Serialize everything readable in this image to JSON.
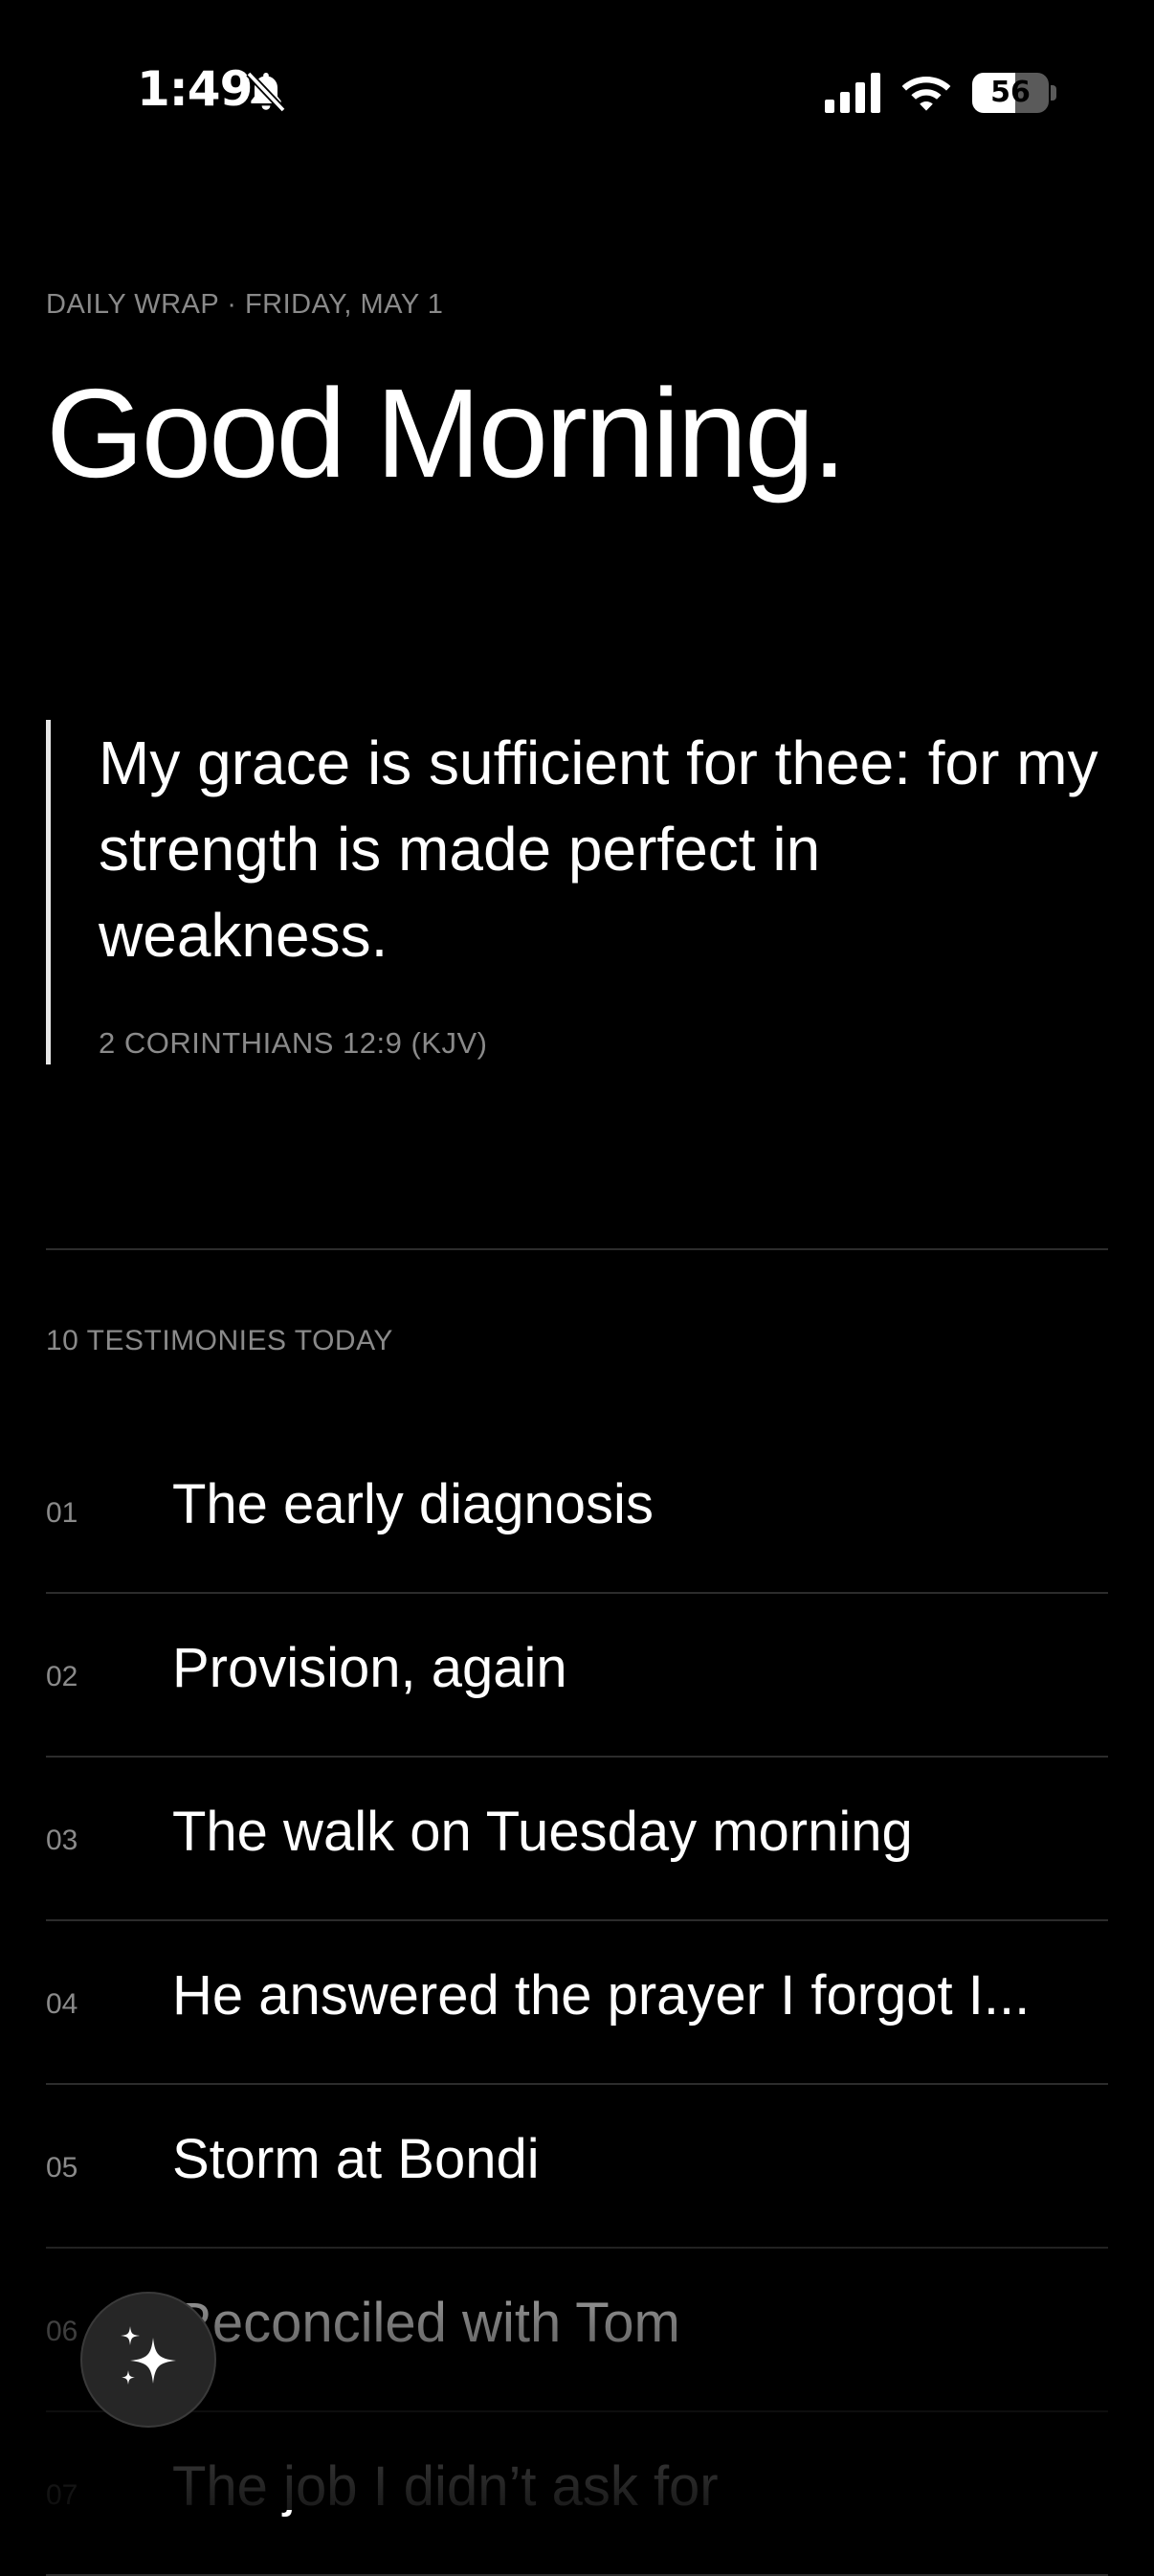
{
  "status_bar": {
    "time": "1:49",
    "battery_percent": "56",
    "icons": [
      "bell-slash-icon",
      "cellular-signal-icon",
      "wifi-icon",
      "battery-icon"
    ]
  },
  "header": {
    "eyebrow": "DAILY WRAP · FRIDAY, MAY 1",
    "greeting": "Good Morning."
  },
  "verse": {
    "text": "My grace is sufficient for thee: for my strength is made perfect in weakness.",
    "reference": "2 CORINTHIANS 12:9 (KJV)"
  },
  "testimonies": {
    "label": "10 TESTIMONIES TODAY",
    "items": [
      {
        "num": "01",
        "title": "The early diagnosis"
      },
      {
        "num": "02",
        "title": "Provision, again"
      },
      {
        "num": "03",
        "title": "The walk on Tuesday morning"
      },
      {
        "num": "04",
        "title": "He answered the prayer I forgot I..."
      },
      {
        "num": "05",
        "title": "Storm at Bondi"
      },
      {
        "num": "06",
        "title": "Reconciled with Tom"
      },
      {
        "num": "07",
        "title": "The job I didn’t ask for"
      }
    ]
  },
  "fab": {
    "icon": "sparkles-icon"
  },
  "colors": {
    "background": "#000000",
    "text": "#ffffff",
    "muted": "#8a8a8a",
    "divider": "#2c2c2c"
  }
}
